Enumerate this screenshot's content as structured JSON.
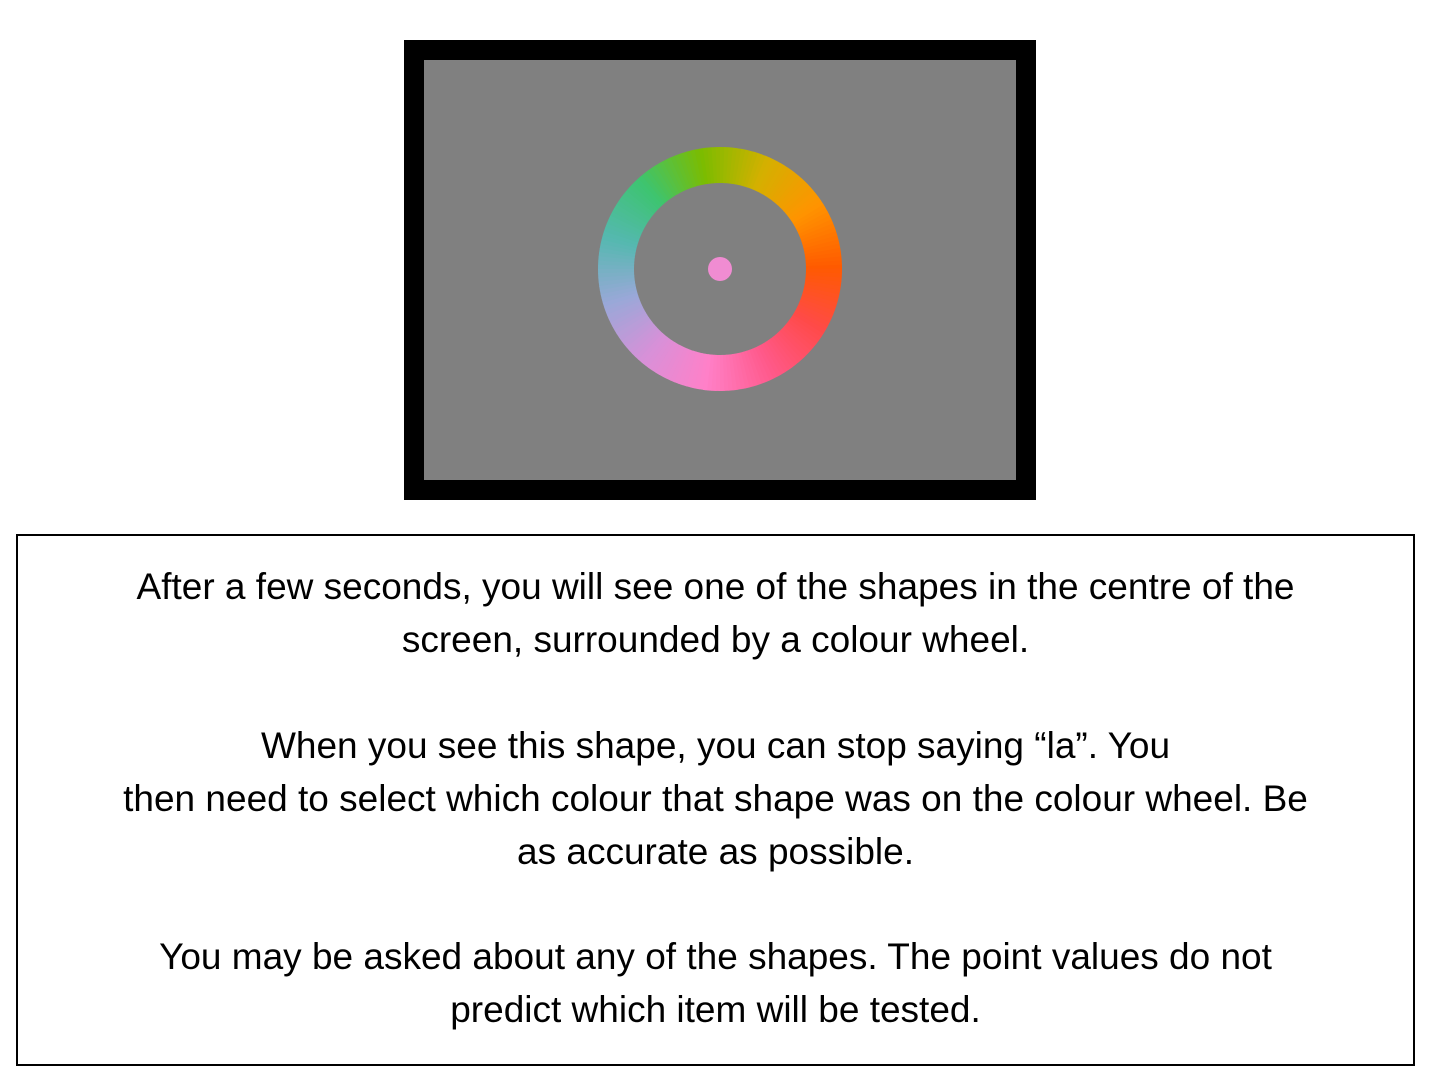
{
  "stimulus": {
    "frame_color": "#000000",
    "background_color": "#808080",
    "center_dot_color": "#f08cd2",
    "wheel": {
      "type": "colour-wheel",
      "hue_stops": [
        "#ff5a00",
        "#ff9400",
        "#d4b000",
        "#7cbc00",
        "#3dc470",
        "#55b8b0",
        "#9aa8d8",
        "#d890d8",
        "#ff80c8",
        "#ff5a8c",
        "#ff4a4a",
        "#ff5a00"
      ]
    }
  },
  "instructions": {
    "paragraph1": {
      "line1": "After a few seconds, you will see one of the shapes in the centre of the",
      "line2": "screen, surrounded by a colour wheel."
    },
    "paragraph2": {
      "line1": "When you see this shape, you can stop saying “la”. You",
      "line2": "then need to select which colour that shape was on the colour wheel. Be",
      "line3": "as accurate as possible."
    },
    "paragraph3": {
      "line1": "You may be asked about any of the shapes. The point values do not",
      "line2": "predict which item will be tested."
    }
  }
}
